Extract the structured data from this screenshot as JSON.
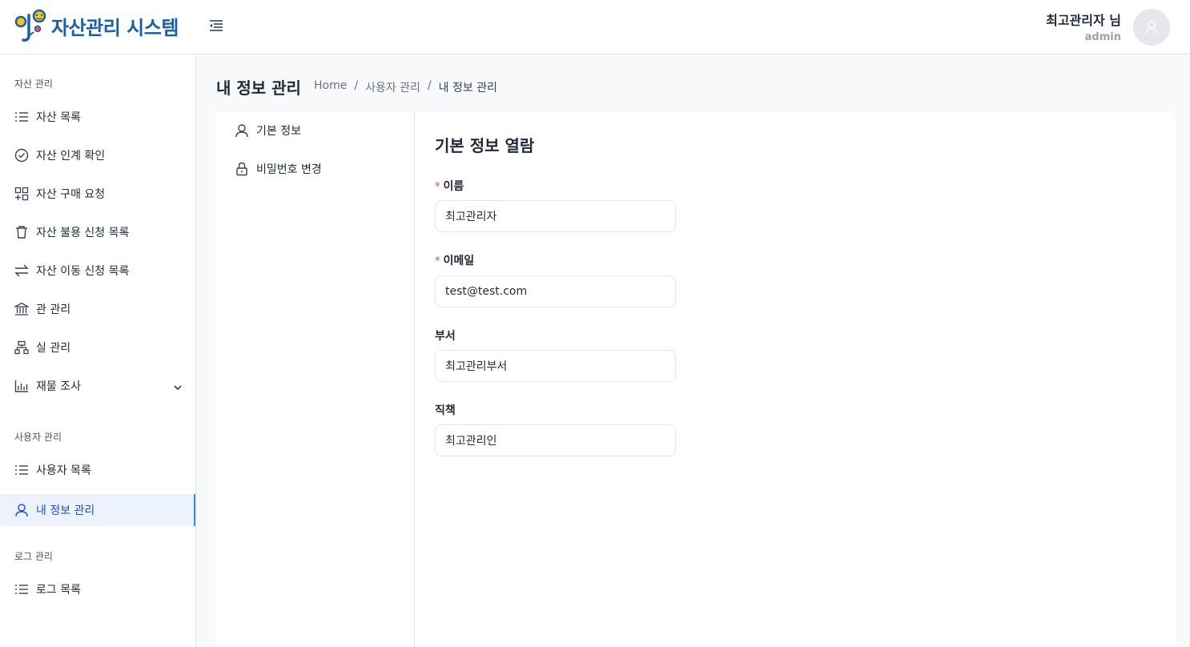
{
  "app": {
    "title": "자산관리 시스템",
    "logo_letters": "영"
  },
  "header": {
    "user_name": "최고관리자 님",
    "user_id": "admin"
  },
  "sidebar": {
    "sections": [
      {
        "title": "자산 관리"
      },
      {
        "title": "사용자 관리"
      },
      {
        "title": "로그 관리"
      }
    ],
    "items": [
      {
        "label": "자산 목록",
        "icon": "list-icon"
      },
      {
        "label": "자산 인계 확인",
        "icon": "check-circle-icon"
      },
      {
        "label": "자산 구매 요청",
        "icon": "appstore-add-icon"
      },
      {
        "label": "자산 불용 신청 목록",
        "icon": "trash-icon"
      },
      {
        "label": "자산 이동 신청 목록",
        "icon": "swap-icon"
      },
      {
        "label": "관 관리",
        "icon": "bank-icon"
      },
      {
        "label": "실 관리",
        "icon": "cluster-icon"
      },
      {
        "label": "재물 조사",
        "icon": "bar-chart-icon"
      },
      {
        "label": "사용자 목록",
        "icon": "list-icon"
      },
      {
        "label": "내 정보 관리",
        "icon": "user-icon"
      },
      {
        "label": "로그 목록",
        "icon": "list-icon"
      }
    ]
  },
  "page": {
    "title": "내 정보 관리",
    "breadcrumb": [
      "Home",
      "사용자 관리",
      "내 정보 관리"
    ],
    "breadcrumb_sep": "/"
  },
  "tabs": [
    {
      "label": "기본 정보",
      "icon": "user-icon"
    },
    {
      "label": "비밀번호 변경",
      "icon": "lock-icon"
    }
  ],
  "form": {
    "title": "기본 정보 열람",
    "required_mark": "*",
    "fields": [
      {
        "label": "이름",
        "value": "최고관리자",
        "required": true
      },
      {
        "label": "이메일",
        "value": "test@test.com",
        "required": true
      },
      {
        "label": "부서",
        "value": "최고관리부서",
        "required": false
      },
      {
        "label": "직책",
        "value": "최고관리인",
        "required": false
      }
    ]
  },
  "colors": {
    "brand": "#1a5fa8",
    "active_bg": "#ecf3fe",
    "active_text": "#1d4ed8",
    "required": "#ef4444"
  }
}
